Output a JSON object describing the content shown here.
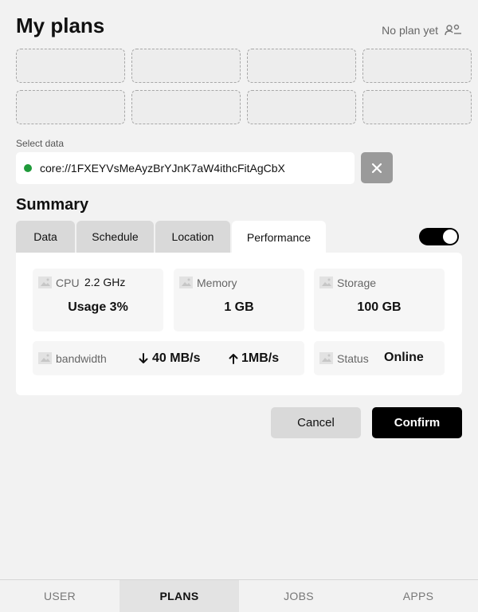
{
  "header": {
    "title": "My plans",
    "plan_status": "No plan yet",
    "plan_status_icon": "users-icon"
  },
  "plan_slots": [
    {},
    {},
    {},
    {},
    {},
    {},
    {},
    {}
  ],
  "data_select": {
    "label": "Select data",
    "value": "core://1FXEYVsMeAyzBrYJnK7aW4ithcFitAgCbX",
    "status_color": "#1f9a3a",
    "clear_icon": "close-icon"
  },
  "summary": {
    "title": "Summary",
    "tabs": [
      {
        "label": "Data"
      },
      {
        "label": "Schedule"
      },
      {
        "label": "Location"
      },
      {
        "label": "Performance",
        "active": true
      }
    ],
    "toggle_on": true,
    "cards": {
      "cpu": {
        "label": "CPU",
        "freq": "2.2 GHz",
        "value": "Usage 3%"
      },
      "memory": {
        "label": "Memory",
        "value": "1 GB"
      },
      "storage": {
        "label": "Storage",
        "value": "100 GB"
      },
      "bandwidth": {
        "label": "bandwidth",
        "down": "40 MB/s",
        "up": "1MB/s"
      },
      "status": {
        "label": "Status",
        "value": "Online"
      }
    }
  },
  "actions": {
    "cancel": "Cancel",
    "confirm": "Confirm"
  },
  "nav": [
    {
      "label": "USER"
    },
    {
      "label": "PLANS",
      "active": true
    },
    {
      "label": "JOBS"
    },
    {
      "label": "APPS"
    }
  ]
}
